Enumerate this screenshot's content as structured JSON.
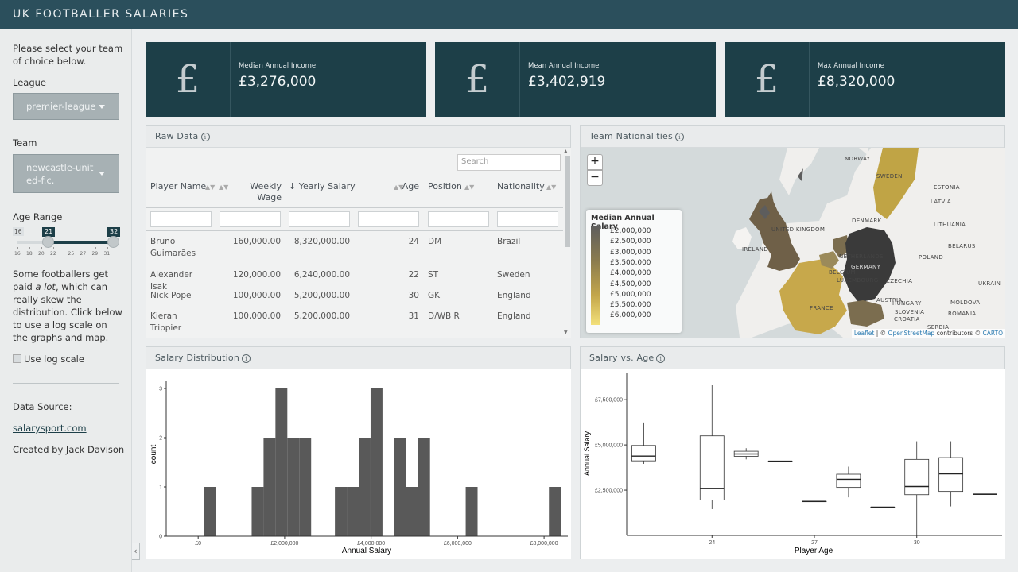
{
  "header": {
    "title": "UK FOOTBALLER SALARIES"
  },
  "sidebar": {
    "intro": "Please select your team of choice below.",
    "league_label": "League",
    "league_value": "premier-league",
    "team_label": "Team",
    "team_value": "newcastle-united-f.c.",
    "age_label": "Age Range",
    "age_min": "16",
    "age_low": "21",
    "age_high": "32",
    "age_ticks": [
      "16",
      "18",
      "20",
      "22",
      "25",
      "27",
      "29",
      "31"
    ],
    "skew_text_1": "Some footballers get paid ",
    "skew_text_em": "a lot",
    "skew_text_2": ", which can really skew the distribution. Click below to use a log scale on the graphs and map.",
    "log_label": "Use log scale",
    "source_label": "Data Source:",
    "source_link": "salarysport.com",
    "credit": "Created by Jack Davison",
    "collapse_glyph": "‹"
  },
  "value_boxes": [
    {
      "title": "Median Annual Income",
      "value": "£3,276,000",
      "icon": "pound-icon",
      "glyph": "£"
    },
    {
      "title": "Mean Annual Income",
      "value": "£3,402,919",
      "icon": "pound-icon",
      "glyph": "£"
    },
    {
      "title": "Max Annual Income",
      "value": "£8,320,000",
      "icon": "pound-icon",
      "glyph": "£"
    }
  ],
  "raw_data": {
    "title": "Raw Data",
    "search_placeholder": "Search",
    "columns": [
      "Player Name",
      "Weekly Wage",
      "↓ Yearly Salary",
      "Age",
      "Position",
      "Nationality"
    ],
    "rows": [
      [
        "Bruno Guimarães",
        "160,000.00",
        "8,320,000.00",
        "24",
        "DM",
        "Brazil"
      ],
      [
        "Alexander Isak",
        "120,000.00",
        "6,240,000.00",
        "22",
        "ST",
        "Sweden"
      ],
      [
        "Nick Pope",
        "100,000.00",
        "5,200,000.00",
        "30",
        "GK",
        "England"
      ],
      [
        "Kieran Trippier",
        "100,000.00",
        "5,200,000.00",
        "31",
        "D/WB R",
        "England"
      ]
    ]
  },
  "map": {
    "title": "Team Nationalities",
    "zoom_in": "+",
    "zoom_out": "−",
    "legend_title": "Median Annual Salary",
    "legend_items": [
      "£2,000,000",
      "£2,500,000",
      "£3,000,000",
      "£3,500,000",
      "£4,000,000",
      "£4,500,000",
      "£5,000,000",
      "£5,500,000",
      "£6,000,000"
    ],
    "labels": [
      "NORWAY",
      "SWEDEN",
      "ESTONIA",
      "LATVIA",
      "DENMARK",
      "LITHUANIA",
      "UNITED KINGDOM",
      "IRELAND",
      "NETHERLANDS",
      "GERMANY",
      "POLAND",
      "BELARUS",
      "BELGIUM",
      "LUXEMBOURG",
      "CZECHIA",
      "UKRAIN",
      "FRANCE",
      "AUSTRIA",
      "HUNGARY",
      "MOLDOVA",
      "SLOVENIA",
      "CROATIA",
      "ROMANIA",
      "SERBIA"
    ],
    "attribution": [
      "Leaflet",
      " | © ",
      "OpenStreetMap",
      " contributors © ",
      "CARTO"
    ]
  },
  "salary_distribution": {
    "title": "Salary Distribution"
  },
  "salary_vs_age": {
    "title": "Salary vs. Age"
  },
  "chart_data": [
    {
      "type": "bar",
      "xlabel": "Annual Salary",
      "ylabel": "count",
      "x_ticks": [
        "£0",
        "£2,000,000",
        "£4,000,000",
        "£6,000,000",
        "£8,000,000"
      ],
      "x_tick_values": [
        0,
        2000000,
        4000000,
        6000000,
        8000000
      ],
      "y_ticks": [
        "0",
        "1",
        "2",
        "3"
      ],
      "ylim": [
        0,
        3
      ],
      "bin_width": 275000,
      "bins": [
        {
          "start": 137500,
          "count": 1
        },
        {
          "start": 1237500,
          "count": 1
        },
        {
          "start": 1512500,
          "count": 2
        },
        {
          "start": 1787500,
          "count": 3
        },
        {
          "start": 2062500,
          "count": 2
        },
        {
          "start": 2337500,
          "count": 2
        },
        {
          "start": 3162500,
          "count": 1
        },
        {
          "start": 3437500,
          "count": 1
        },
        {
          "start": 3712500,
          "count": 2
        },
        {
          "start": 3987500,
          "count": 3
        },
        {
          "start": 4537500,
          "count": 2
        },
        {
          "start": 4812500,
          "count": 1
        },
        {
          "start": 5087500,
          "count": 2
        },
        {
          "start": 6187500,
          "count": 1
        },
        {
          "start": 8112500,
          "count": 1
        }
      ],
      "grid": false
    },
    {
      "type": "box",
      "xlabel": "Player Age",
      "ylabel": "Annual Salary",
      "x_ticks": [
        "24",
        "27",
        "30"
      ],
      "x_tick_values": [
        24,
        27,
        30
      ],
      "y_ticks": [
        "£2,500,000",
        "£5,000,000",
        "£7,500,000"
      ],
      "y_tick_values": [
        2500000,
        5000000,
        7500000
      ],
      "xlim": [
        21.5,
        32.5
      ],
      "ylim": [
        0,
        9000000
      ],
      "grid": false,
      "boxes": [
        {
          "age": 22,
          "min": 3950000,
          "q1": 4120000,
          "median": 4380000,
          "q3": 4970000,
          "max": 6240000
        },
        {
          "age": 24,
          "min": 1450000,
          "q1": 1950000,
          "median": 2600000,
          "q3": 5500000,
          "max": 8320000
        },
        {
          "age": 25,
          "min": 4200000,
          "q1": 4370000,
          "median": 4500000,
          "q3": 4650000,
          "max": 4820000
        },
        {
          "age": 26,
          "min": 4100000,
          "q1": 4100000,
          "median": 4100000,
          "q3": 4100000,
          "max": 4100000
        },
        {
          "age": 27,
          "min": 1880000,
          "q1": 1880000,
          "median": 1880000,
          "q3": 1880000,
          "max": 1880000
        },
        {
          "age": 28,
          "min": 2100000,
          "q1": 2650000,
          "median": 3100000,
          "q3": 3380000,
          "max": 3800000
        },
        {
          "age": 29,
          "min": 1560000,
          "q1": 1560000,
          "median": 1560000,
          "q3": 1560000,
          "max": 1560000
        },
        {
          "age": 30,
          "min": 0,
          "q1": 2250000,
          "median": 2700000,
          "q3": 4200000,
          "max": 5200000
        },
        {
          "age": 31,
          "min": 1600000,
          "q1": 2430000,
          "median": 3400000,
          "q3": 4300000,
          "max": 5200000
        },
        {
          "age": 32,
          "min": 2280000,
          "q1": 2280000,
          "median": 2280000,
          "q3": 2280000,
          "max": 2280000
        }
      ]
    }
  ]
}
